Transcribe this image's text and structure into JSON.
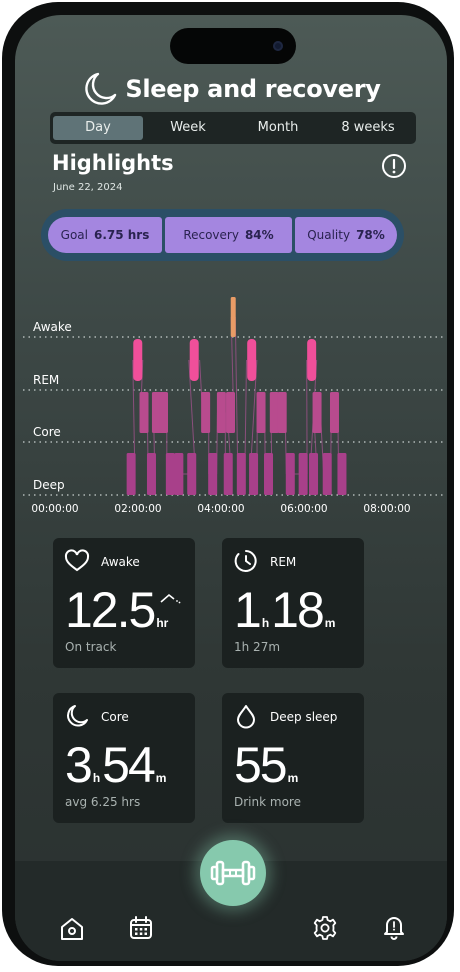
{
  "app": {
    "title": "Sleep and recovery"
  },
  "tabs": [
    {
      "label": "Day",
      "active": true
    },
    {
      "label": "Week",
      "active": false
    },
    {
      "label": "Month",
      "active": false
    },
    {
      "label": "8 weeks",
      "active": false
    }
  ],
  "highlights": {
    "title": "Highlights",
    "date": "June 22, 2024"
  },
  "stats": [
    {
      "label": "Goal",
      "value": "6.75 hrs"
    },
    {
      "label": "Recovery",
      "value": "84%"
    },
    {
      "label": "Quality",
      "value": "78%"
    }
  ],
  "chart_data": {
    "type": "timeline",
    "stages": [
      "Awake",
      "REM",
      "Core",
      "Deep"
    ],
    "x_ticks": [
      "00:00:00",
      "02:00:00",
      "04:00:00",
      "06:00:00",
      "08:00:00"
    ],
    "x_range_hours": [
      0,
      8
    ],
    "segments": [
      {
        "stage": "Deep",
        "start": 1.6,
        "end": 1.78
      },
      {
        "stage": "Core",
        "start": 1.92,
        "end": 2.08
      },
      {
        "stage": "Deep",
        "start": 2.1,
        "end": 2.26
      },
      {
        "stage": "Core",
        "start": 2.23,
        "end": 2.37
      },
      {
        "stage": "Core",
        "start": 2.39,
        "end": 2.55
      },
      {
        "stage": "Deep",
        "start": 2.55,
        "end": 2.72
      },
      {
        "stage": "Deep",
        "start": 2.76,
        "end": 2.92
      },
      {
        "stage": "REM",
        "start": 1.73,
        "end": 1.97
      },
      {
        "stage": "Deep",
        "start": 3.06,
        "end": 3.24
      },
      {
        "stage": "REM",
        "start": 3.08,
        "end": 3.34
      },
      {
        "stage": "Core",
        "start": 3.41,
        "end": 3.56
      },
      {
        "stage": "Deep",
        "start": 3.56,
        "end": 3.75
      },
      {
        "stage": "Core",
        "start": 3.77,
        "end": 3.96
      },
      {
        "stage": "Deep",
        "start": 3.96,
        "end": 4.1
      },
      {
        "stage": "Core",
        "start": 4.01,
        "end": 4.16
      },
      {
        "stage": "Awake",
        "start": 4.1,
        "end": 4.2
      },
      {
        "stage": "Deep",
        "start": 4.26,
        "end": 4.43
      },
      {
        "stage": "REM",
        "start": 4.47,
        "end": 4.72
      },
      {
        "stage": "Deep",
        "start": 4.56,
        "end": 4.72
      },
      {
        "stage": "Core",
        "start": 4.73,
        "end": 4.91
      },
      {
        "stage": "Deep",
        "start": 4.92,
        "end": 5.08
      },
      {
        "stage": "Core",
        "start": 5.06,
        "end": 5.22
      },
      {
        "stage": "Core",
        "start": 5.26,
        "end": 5.4
      },
      {
        "stage": "Deep",
        "start": 5.43,
        "end": 5.62
      },
      {
        "stage": "Deep",
        "start": 5.74,
        "end": 5.93
      },
      {
        "stage": "REM",
        "start": 5.92,
        "end": 6.16
      },
      {
        "stage": "Deep",
        "start": 6.0,
        "end": 6.17
      },
      {
        "stage": "Core",
        "start": 6.09,
        "end": 6.25
      },
      {
        "stage": "Deep",
        "start": 6.33,
        "end": 6.5
      },
      {
        "stage": "Core",
        "start": 6.51,
        "end": 6.67
      },
      {
        "stage": "Deep",
        "start": 6.69,
        "end": 6.85
      }
    ],
    "colors": {
      "Awake": "#e99c66",
      "REM": "#f04f9a",
      "Core": "#b84b8e",
      "Deep": "#a8408a",
      "grid": "#c8d0ce"
    }
  },
  "cards": {
    "awake": {
      "label": "Awake",
      "value": "12.5",
      "unit": "hr",
      "sub": "On track",
      "icon": "heart-icon"
    },
    "rem": {
      "label": "REM",
      "hours": "1",
      "hours_unit": "h",
      "minutes": "18",
      "minutes_unit": "m",
      "sub": "1h 27m",
      "icon": "clock-icon"
    },
    "core": {
      "label": "Core",
      "hours": "3",
      "hours_unit": "h",
      "minutes": "54",
      "minutes_unit": "m",
      "sub": "avg 6.25 hrs",
      "icon": "moon-icon"
    },
    "deep": {
      "label": "Deep sleep",
      "minutes": "55",
      "minutes_unit": "m",
      "sub": "Drink more",
      "icon": "water-drop-icon"
    }
  },
  "nav": {
    "items": [
      "home-icon",
      "calendar-icon",
      "dumbbell-icon",
      "settings-gear-icon",
      "bell-alert-icon"
    ]
  },
  "colors": {
    "accent": "#a486e0",
    "fab": "#86c9ad",
    "card_bg": "#1b2120"
  }
}
